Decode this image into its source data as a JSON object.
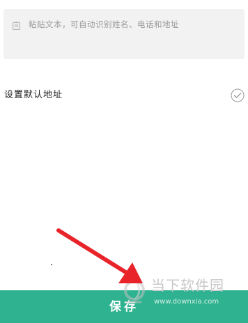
{
  "paste_area": {
    "icon": "clipboard-icon",
    "placeholder": "粘贴文本，可自动识别姓名、电话和地址"
  },
  "default_address": {
    "label": "设置默认地址",
    "toggle_icon": "check-circle-icon",
    "checked": true
  },
  "annotation": {
    "arrow_color": "#e8242a"
  },
  "save_button": {
    "label": "保存",
    "color": "#2fb28f"
  },
  "watermark": {
    "title": "当下软件园",
    "url": "www.downxia.com"
  }
}
